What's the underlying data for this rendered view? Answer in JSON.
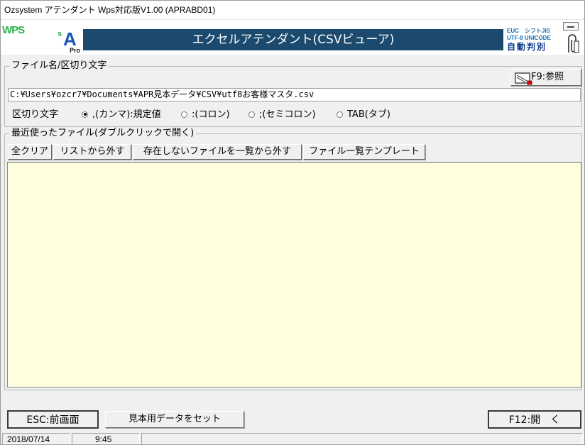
{
  "window": {
    "title": "Ozsystem アテンダント Wps対応版V1.00 (APRABD01)"
  },
  "header": {
    "wps_logo": "WPS",
    "sa_logo": {
      "s": "s",
      "a": "A",
      "pro": "Pro"
    },
    "banner_title": "エクセルアテンダント(CSVビューア)",
    "encoding_box": {
      "line1": "EUC　シフトJIS",
      "line2": "UTF-8 UNICODE",
      "line3": "自動判別"
    }
  },
  "file_group": {
    "legend": "ファイル名/区切り文字",
    "browse_label": "F9:参照",
    "path_value": "C:¥Users¥ozcr7¥Documents¥APR見本データ¥CSV¥utf8お客様マスタ.csv",
    "delimiter_label": "区切り文字",
    "options": [
      {
        "label": ",(カンマ):規定値",
        "selected": true
      },
      {
        "label": ":(コロン)",
        "selected": false
      },
      {
        "label": ";(セミコロン)",
        "selected": false
      },
      {
        "label": "TAB(タブ)",
        "selected": false
      }
    ]
  },
  "recent_group": {
    "legend": "最近使ったファイル(ダブルクリックで開く)",
    "toolbar": {
      "clear_all": "全クリア",
      "remove_from_list": "リストから外す",
      "remove_missing": "存在しないファイルを一覧から外す",
      "list_template": "ファイル一覧テンプレート"
    },
    "items": []
  },
  "bottom": {
    "esc_label": "ESC:前画面",
    "sample_label": "見本用データをセット",
    "f12_label": "F12:開　く"
  },
  "status": {
    "date": "2018/07/14",
    "time": "9:45"
  },
  "colors": {
    "banner": "#1b4a6e",
    "list_background": "#ffffe0",
    "window_background": "#f0f0f0"
  }
}
